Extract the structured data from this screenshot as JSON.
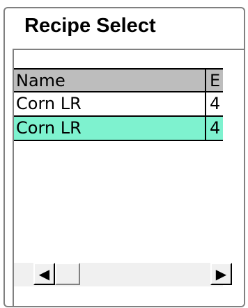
{
  "panel": {
    "title": "Recipe Select"
  },
  "table": {
    "columns": [
      "Name",
      "E"
    ],
    "rows": [
      [
        "Corn LR",
        "4"
      ],
      [
        "Corn LR",
        "4"
      ]
    ],
    "selected_row": 1
  },
  "scrollbar": {
    "left_arrow": "◀",
    "right_arrow": "▶"
  },
  "colors": {
    "header_bg": "#bdbdbd",
    "selected_row_bg": "#7ef2cf",
    "border": "#808080"
  }
}
